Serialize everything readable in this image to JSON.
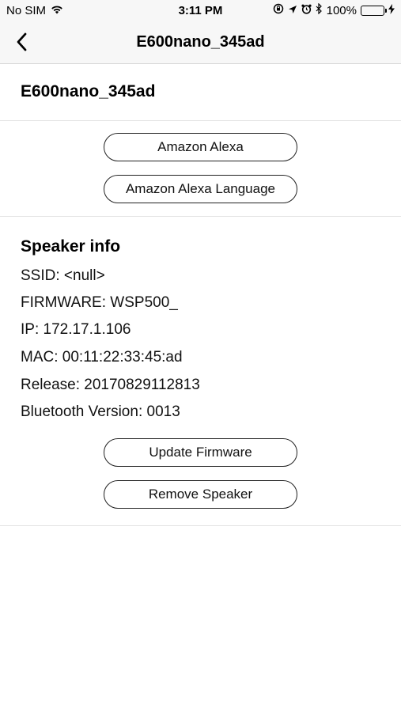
{
  "status_bar": {
    "carrier": "No SIM",
    "time": "3:11 PM",
    "battery_percent": "100%",
    "battery_level": 1.0,
    "battery_color": "#4cd964"
  },
  "nav": {
    "title": "E600nano_345ad",
    "back_icon": "chevron-left-icon"
  },
  "device": {
    "name": "E600nano_345ad"
  },
  "alexa": {
    "amazon_alexa_label": "Amazon Alexa",
    "alexa_language_label": "Amazon Alexa Language"
  },
  "speaker_info": {
    "heading": "Speaker info",
    "ssid": "SSID: <null>",
    "firmware": "FIRMWARE: WSP500_",
    "ip": "IP: 172.17.1.106",
    "mac": "MAC: 00:11:22:33:45:ad",
    "release": "Release: 20170829112813",
    "bluetooth_version": "Bluetooth Version: 0013"
  },
  "actions": {
    "update_firmware_label": "Update Firmware",
    "remove_speaker_label": "Remove Speaker"
  }
}
